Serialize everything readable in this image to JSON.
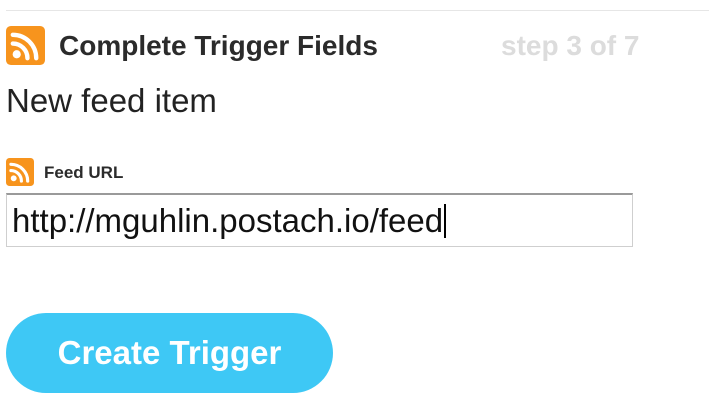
{
  "header": {
    "title": "Complete Trigger Fields",
    "step": "step 3 of 7",
    "icon": "rss-icon"
  },
  "trigger": {
    "name": "New feed item"
  },
  "form": {
    "feed_url": {
      "label": "Feed URL",
      "icon": "rss-icon",
      "value": "http://mguhlin.postach.io/feed"
    }
  },
  "actions": {
    "create_label": "Create Trigger"
  },
  "colors": {
    "rss_orange": "#f7941d",
    "button_blue": "#3ec8f5",
    "step_gray": "#dcdcdc"
  }
}
